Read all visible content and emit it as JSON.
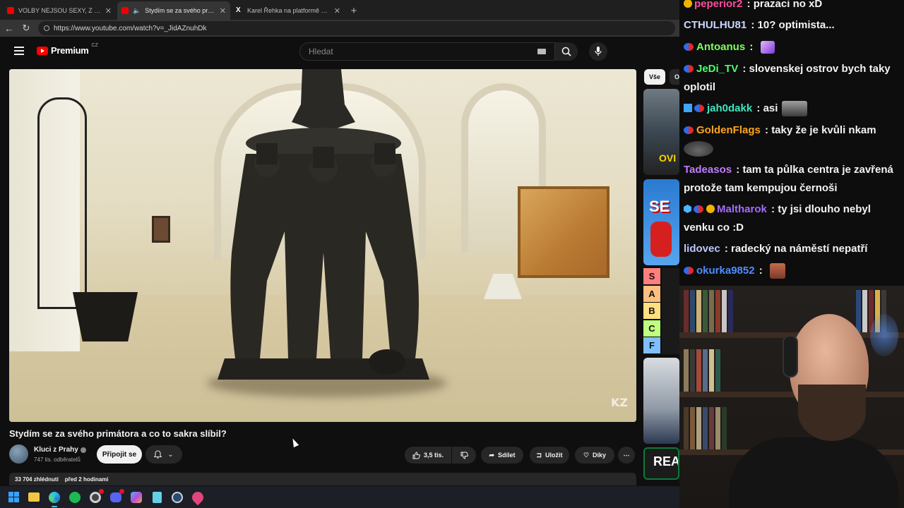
{
  "browser": {
    "tabs": [
      {
        "title": "VOLBY NEJSOU SEXY, Z NICH NEMŮ",
        "active": false,
        "favicon": "youtube-icon"
      },
      {
        "title": "Stydím se za svého primátora",
        "active": true,
        "favicon": "youtube-icon"
      },
      {
        "title": "Karel Řehka na platformě X: „Po v",
        "active": false,
        "favicon": "x-icon"
      }
    ],
    "url": "https://www.youtube.com/watch?v=_JidAZnuhDk"
  },
  "youtube": {
    "logo_text": "Premium",
    "logo_region": "CZ",
    "search_placeholder": "Hledat",
    "video": {
      "watermark": "KZ",
      "title": "Stydím se za svého primátora a co to sakra slíbil?",
      "channel_name": "Kluci z Prahy",
      "subscribers": "747 tis. odběratelů",
      "join_label": "Připojit se",
      "likes": "3,5 tis.",
      "share_label": "Sdílet",
      "save_label": "Uložit",
      "thanks_label": "Díky",
      "views": "33 704 zhlédnutí",
      "published": "před 2 hodinami"
    },
    "chips": {
      "all": "Vše",
      "other": "O"
    },
    "recommendations": {
      "t1_text": "OVI",
      "t2_text": "SE",
      "tier_labels": [
        "S",
        "A",
        "B",
        "C",
        "F"
      ],
      "tier_colors": [
        "#ff7f7f",
        "#ffbf7f",
        "#ffdf7f",
        "#bfff7f",
        "#7fbfff"
      ],
      "t5_text": "REA"
    }
  },
  "chat": {
    "messages": [
      {
        "user": "peperior2",
        "color": "#ff4d9d",
        "text": "prazaci no xD",
        "badges": [
          "gold"
        ]
      },
      {
        "user": "CTHULHU81",
        "color": "#c9d6ff",
        "text": "10? optimista...",
        "badges": []
      },
      {
        "user": "Antoanus",
        "color": "#7dff5a",
        "text": "",
        "badges": [
          "sub"
        ],
        "emote": "party"
      },
      {
        "user": "JeDi_TV",
        "color": "#4cff6a",
        "text": "slovenskej ostrov bych taky oplotil",
        "badges": [
          "sub"
        ]
      },
      {
        "user": "jah0dakk",
        "color": "#3ee7c0",
        "text": "asi",
        "badges": [
          "square",
          "sub"
        ],
        "emote": "face"
      },
      {
        "user": "GoldenFlags",
        "color": "#ffa51f",
        "text": "taky že je kvůli nkam",
        "badges": [
          "sub"
        ],
        "emote": "sweet"
      },
      {
        "user": "Tadeasos",
        "color": "#c27cff",
        "text": "tam ta půlka centra je zavřená protože tam kempujou černoši",
        "badges": []
      },
      {
        "user": "Maltharok",
        "color": "#a56bff",
        "text": "ty jsi dlouho nebyl venku co :D",
        "badges": [
          "cube",
          "sub",
          "one"
        ]
      },
      {
        "user": "lidovec",
        "color": "#bcc6ff",
        "text": "radecký na náměstí nepatří",
        "badges": []
      },
      {
        "user": "okurka9852",
        "color": "#4f8dff",
        "text": "",
        "badges": [
          "sub"
        ],
        "emote": "guy"
      }
    ]
  },
  "taskbar": {
    "icons": [
      "windows-start-icon",
      "file-explorer-icon",
      "edge-icon",
      "spotify-icon",
      "chrome-icon",
      "discord-icon",
      "copilot-icon",
      "notepad-icon",
      "steam-icon",
      "maps-icon"
    ]
  }
}
